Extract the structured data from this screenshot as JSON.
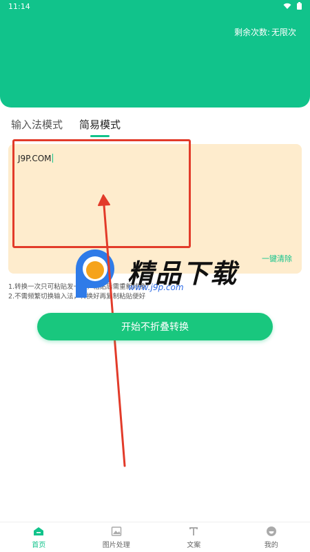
{
  "statusbar": {
    "time": "11:14"
  },
  "header": {
    "remaining_label": "剩余次数:",
    "remaining_value": "无限次"
  },
  "tabs": [
    {
      "label": "输入法模式",
      "active": false
    },
    {
      "label": "简易模式",
      "active": true
    }
  ],
  "editor": {
    "text": "J9P.COM",
    "clear_label": "一键清除"
  },
  "notes": [
    "1.转换一次只可粘贴发一次，粘贴后需重新转换",
    "2.不需频繁切换输入法，转换好再复制粘贴便好"
  ],
  "watermark": {
    "title": "精品下载",
    "url": "www.j9p.com"
  },
  "start_button": {
    "label": "开始不折叠转换"
  },
  "bottom_nav": [
    {
      "label": "首页",
      "icon": "home-icon",
      "active": true
    },
    {
      "label": "图片处理",
      "icon": "image-icon",
      "active": false
    },
    {
      "label": "文案",
      "icon": "text-icon",
      "active": false
    },
    {
      "label": "我的",
      "icon": "profile-icon",
      "active": false
    }
  ],
  "colors": {
    "accent": "#11c38b",
    "editor_bg": "#feeccd",
    "annotation": "#e23b2a"
  }
}
